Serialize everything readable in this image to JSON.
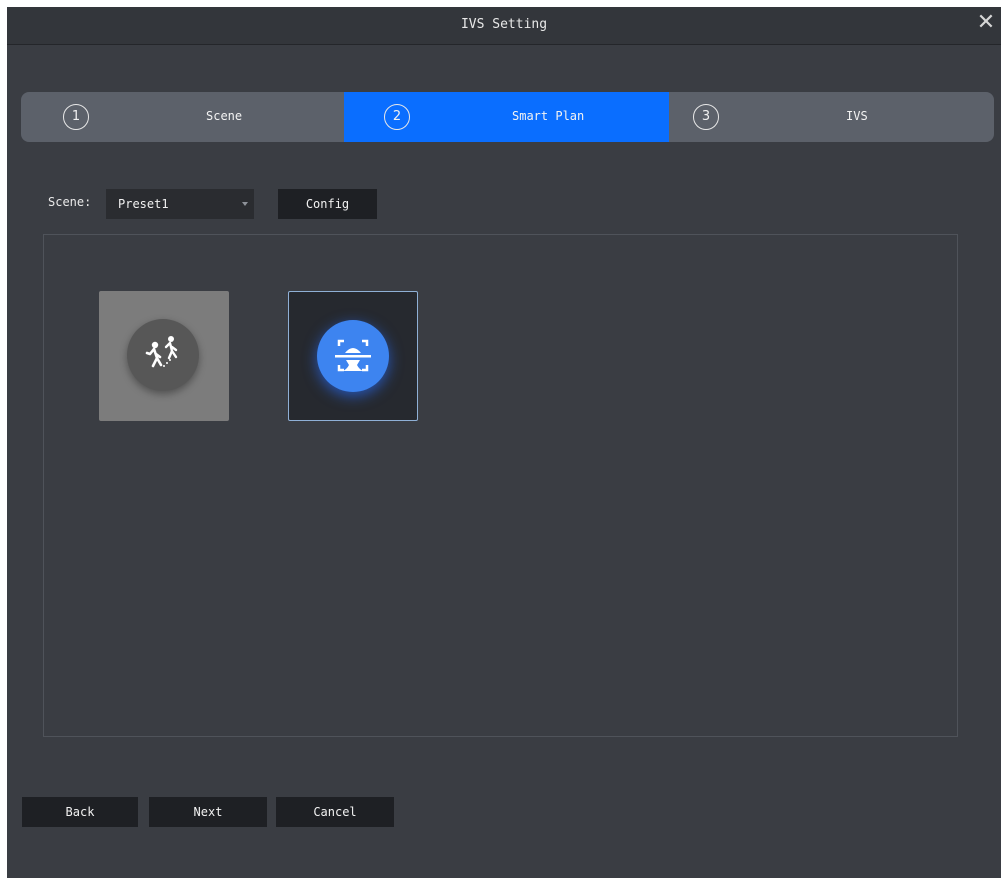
{
  "window": {
    "title": "IVS Setting"
  },
  "steps": [
    {
      "num": "1",
      "label": "Scene",
      "active": false
    },
    {
      "num": "2",
      "label": "Smart Plan",
      "active": true
    },
    {
      "num": "3",
      "label": "IVS",
      "active": false
    }
  ],
  "scene": {
    "label": "Scene:",
    "value": "Preset1",
    "config_label": "Config"
  },
  "plans": [
    {
      "icon": "people-walking-icon",
      "selected": false
    },
    {
      "icon": "face-detection-icon",
      "selected": true
    }
  ],
  "footer": {
    "back_label": "Back",
    "next_label": "Next",
    "cancel_label": "Cancel"
  },
  "colors": {
    "active_step": "#0a6eff",
    "face_icon": "#3d84f0",
    "dialog_bg": "#3a3d43"
  }
}
